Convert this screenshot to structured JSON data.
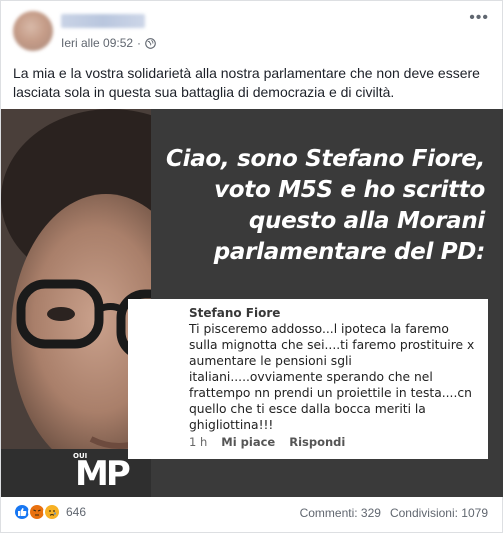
{
  "post": {
    "timestamp": "Ieri alle 09:52",
    "text": "La mia e la vostra solidarietà alla nostra parlamentare che non deve essere lasciata sola in questa sua battaglia di democrazia e di civiltà."
  },
  "image": {
    "headline": [
      "Ciao, sono Stefano Fiore,",
      "voto M5S e ho scritto",
      "questo alla Morani",
      "parlamentare del PD:"
    ],
    "comment": {
      "author": "Stefano Fiore",
      "body": "Ti pisceremo addosso...l ipoteca la faremo sulla mignotta che sei....ti faremo prostituire x aumentare le pensioni sgli italiani.....ovviamente sperando che nel frattempo nn prendi un proiettile in testa....cn quello che ti esce dalla bocca meriti la ghigliottina!!!",
      "time": "1 h",
      "like_label": "Mi piace",
      "reply_label": "Rispondi"
    },
    "logo_small": "OUI",
    "logo_big": "MP"
  },
  "footer": {
    "reaction_count": "646",
    "comments": "Commenti: 329",
    "shares": "Condivisioni: 1079"
  }
}
